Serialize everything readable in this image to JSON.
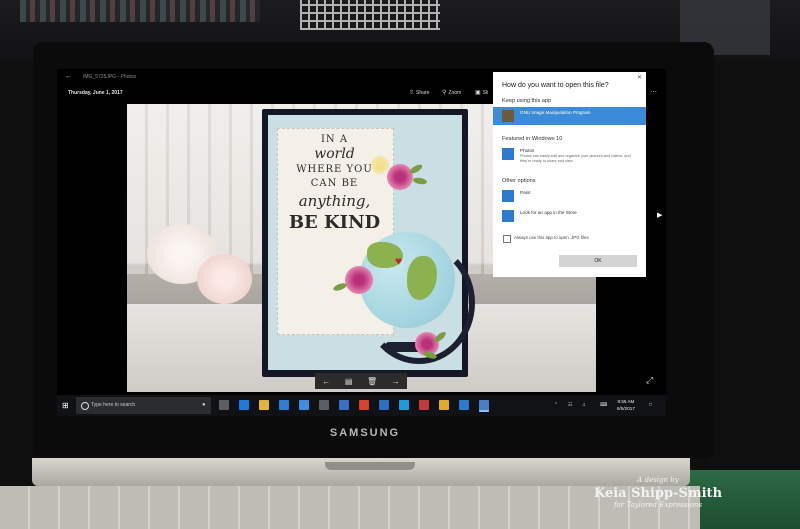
{
  "app": {
    "file_name": "IMG_5735JPG - Photos",
    "date": "Thursday, June 1, 2017",
    "toolbar": {
      "share": "Share",
      "zoom": "Zoom",
      "slideshow": "Sli"
    }
  },
  "card": {
    "lines": [
      "IN A",
      "world",
      "WHERE YOU",
      "CAN BE",
      "anything,",
      "BE KIND"
    ]
  },
  "dialog": {
    "title": "How do you want to open this file?",
    "keep_section": "Keep using this app",
    "keep_app": "GNU Image Manipulation Program",
    "featured_section": "Featured in Windows 10",
    "featured_app": "Photos",
    "featured_desc": "Photos can easily edit and organize your pictures and videos, and they're ready to share and view",
    "other_section": "Other options",
    "paint": "Paint",
    "store": "Look for an app in the Store",
    "always_use": "Always use this app to open .JPG files",
    "ok": "OK"
  },
  "taskbar": {
    "search_placeholder": "Type here to search",
    "time": "9:56 AM",
    "date": "6/5/2017"
  },
  "brand": "SAMSUNG",
  "watermark": {
    "line1": "A design by",
    "line2": "Keia Shipp-Smith",
    "line3": "for Taylored Expressions"
  },
  "icons": {
    "back": "back-arrow-icon",
    "share": "share-icon",
    "zoom": "zoom-icon",
    "prev": "left-arrow-icon",
    "next": "right-arrow-icon",
    "delete": "trash-icon",
    "slideshow": "slideshow-icon"
  }
}
